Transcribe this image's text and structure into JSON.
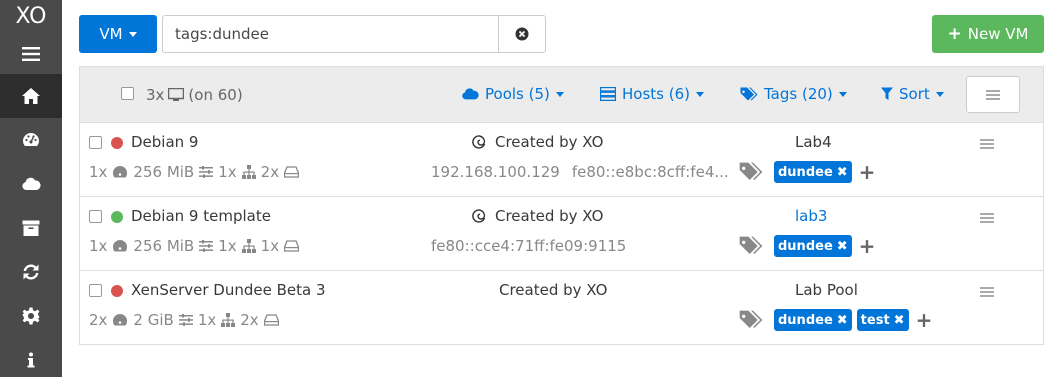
{
  "sidebar": {
    "logo": "XO",
    "items": [
      {
        "icon": "menu-icon"
      },
      {
        "icon": "home-icon",
        "active": true
      },
      {
        "icon": "dashboard-icon"
      },
      {
        "icon": "cloud-icon"
      },
      {
        "icon": "archive-icon"
      },
      {
        "icon": "refresh-icon"
      },
      {
        "icon": "settings-icon"
      },
      {
        "icon": "info-icon"
      }
    ]
  },
  "toolbar": {
    "type_label": "VM",
    "search_value": "tags:dundee",
    "new_vm_label": "New VM",
    "new_vm_plus": "+"
  },
  "header": {
    "count_label": "3x",
    "count_total": "(on 60)",
    "pools_label": "Pools (5)",
    "hosts_label": "Hosts (6)",
    "tags_label": "Tags (20)",
    "sort_label": "Sort"
  },
  "rows": [
    {
      "name": "Debian 9",
      "status": "halted",
      "status_color": "#d9534f",
      "creator": "Created by XO",
      "host": "Lab4",
      "cpus": "1x",
      "memory": "256 MiB",
      "networks": "1x",
      "disks": "2x",
      "ips": [
        "192.168.100.129",
        "fe80::e8bc:8cff:fe4..."
      ],
      "tags": [
        "dundee"
      ]
    },
    {
      "name": "Debian 9 template",
      "status": "running",
      "status_color": "#5cb85c",
      "creator": "Created by XO",
      "host": "lab3",
      "cpus": "1x",
      "memory": "256 MiB",
      "networks": "1x",
      "disks": "1x",
      "ips": [
        "fe80::cce4:71ff:fe09:9115"
      ],
      "tags": [
        "dundee"
      ]
    },
    {
      "name": "XenServer Dundee Beta 3",
      "status": "halted",
      "status_color": "#d9534f",
      "creator": "Created by XO",
      "host": "Lab Pool",
      "cpus": "2x",
      "memory": "2 GiB",
      "networks": "1x",
      "disks": "2x",
      "ips": [],
      "tags": [
        "dundee",
        "test"
      ]
    }
  ],
  "colors": {
    "primary": "#0275d8",
    "success": "#5cb85c",
    "sidebar": "#4a4a4a",
    "halted": "#d9534f"
  }
}
